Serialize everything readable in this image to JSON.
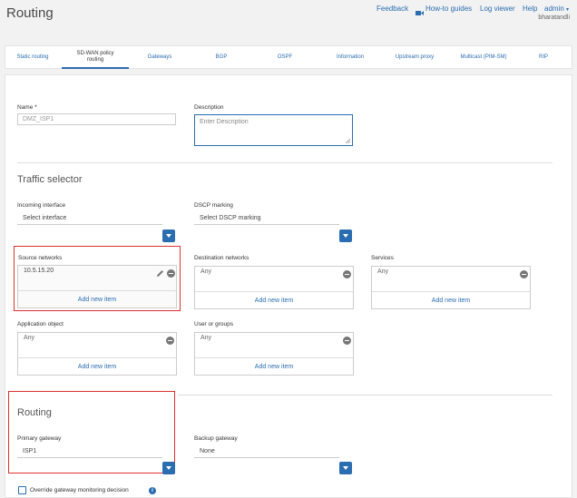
{
  "page": {
    "title": "Routing"
  },
  "toolbar": {
    "feedback": "Feedback",
    "how_to": "How-to guides",
    "log_viewer": "Log viewer",
    "help": "Help",
    "user": "admin",
    "user_sub": "bharatandli"
  },
  "tabs": [
    "Static routing",
    "SD-WAN policy routing",
    "Gateways",
    "BGP",
    "OSPF",
    "Information",
    "Upstream proxy",
    "Multicast (PIM-SM)",
    "RIP"
  ],
  "active_tab": "SD-WAN policy routing",
  "form": {
    "name_label": "Name *",
    "name_value": "DMZ_ISP1",
    "desc_label": "Description",
    "desc_placeholder": "Enter Description"
  },
  "traffic": {
    "heading": "Traffic selector",
    "incoming_label": "Incoming interface",
    "incoming_value": "Select interface",
    "dscp_label": "DSCP marking",
    "dscp_value": "Select DSCP marking",
    "source_label": "Source networks",
    "source_item": "10.5.15.20",
    "dest_label": "Destination networks",
    "dest_item": "Any",
    "services_label": "Services",
    "services_item": "Any",
    "app_label": "Application object",
    "app_item": "Any",
    "users_label": "User or groups",
    "users_item": "Any",
    "add_new": "Add new item"
  },
  "routing": {
    "heading": "Routing",
    "primary_label": "Primary gateway",
    "primary_value": "ISP1",
    "backup_label": "Backup gateway",
    "backup_value": "None",
    "override_label": "Override gateway monitoring decision"
  },
  "colors": {
    "accent": "#2a6db0",
    "highlight": "#e03030"
  }
}
